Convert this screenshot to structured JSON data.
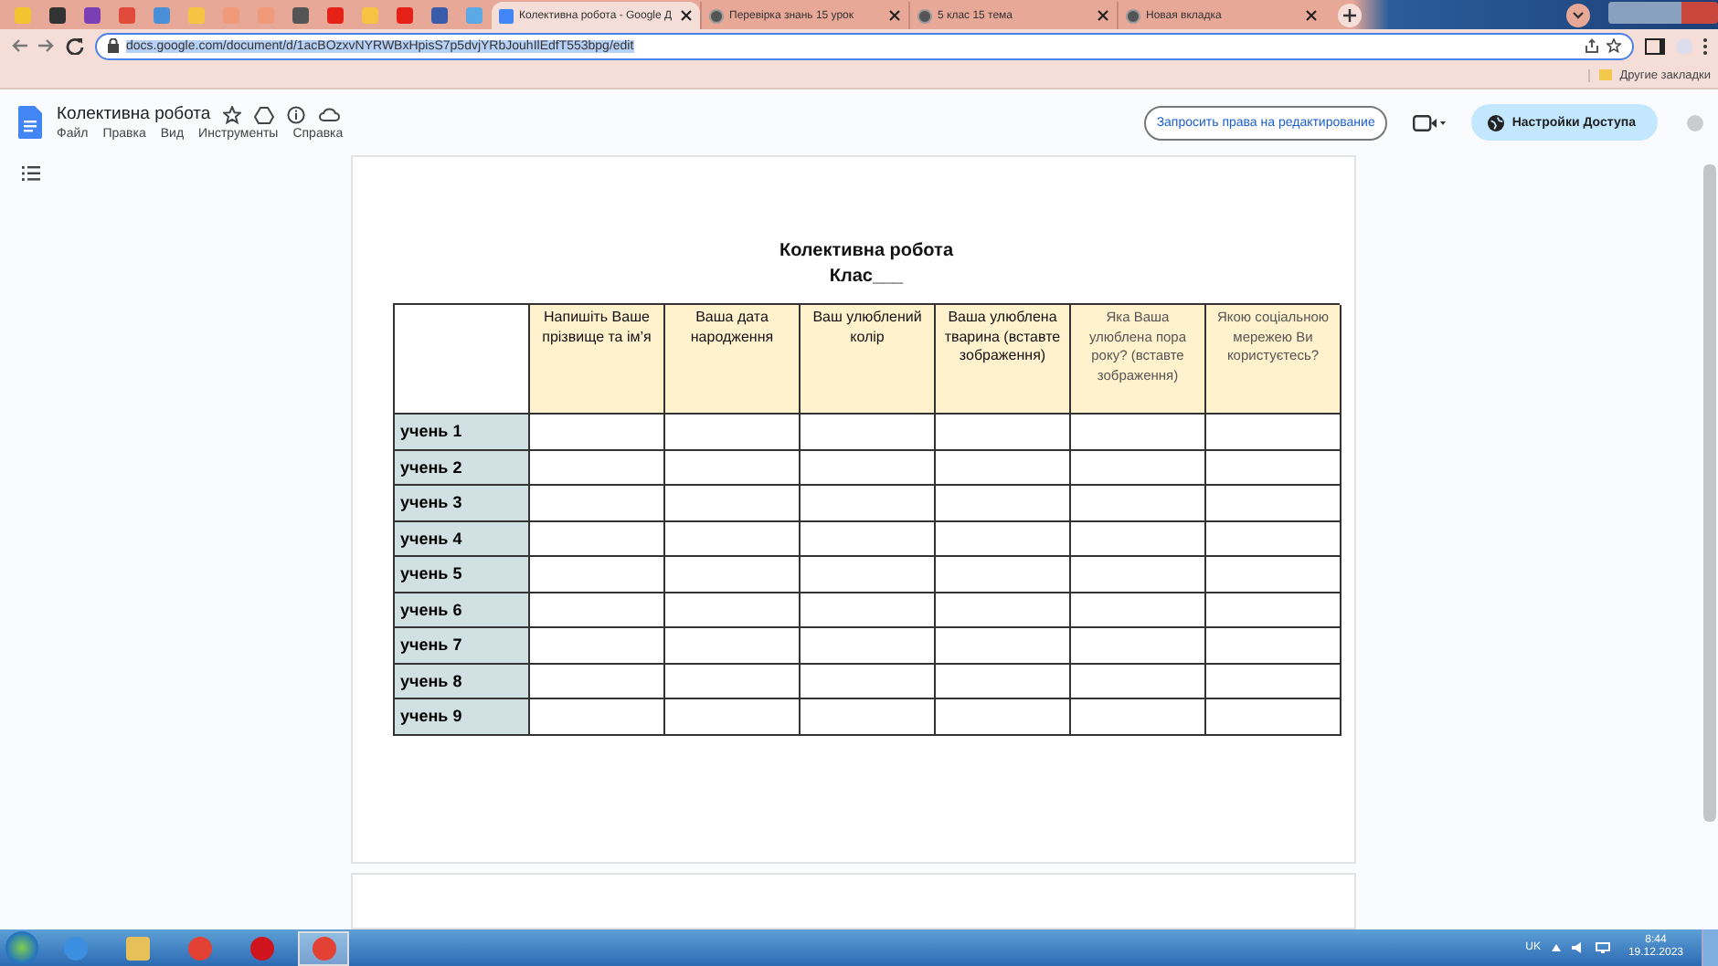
{
  "browser": {
    "tabs": [
      {
        "title": "Колективна робота - Google Д",
        "selected": true
      },
      {
        "title": "Перевірка знань 15 урок",
        "selected": false
      },
      {
        "title": "5 клас 15 тема",
        "selected": false
      },
      {
        "title": "Новая вкладка",
        "selected": false
      }
    ],
    "url": "docs.google.com/document/d/1acBOzxvNYRWBxHpisS7p5dvjYRbJouhIlEdfT553bpg/edit",
    "bookmarks": [
      "Другие закладки"
    ]
  },
  "docs": {
    "title": "Колективна робота",
    "menu": [
      "Файл",
      "Правка",
      "Вид",
      "Инструменты",
      "Справка"
    ],
    "request_button": "Запросить права на редактирование",
    "share_button": "Настройки Доступа"
  },
  "document": {
    "heading": "Колективна робота",
    "subheading": "Клас___",
    "table": {
      "columns": [
        {
          "label": "Напишіть Ваше прізвище та ім’я",
          "muted": false
        },
        {
          "label": "Ваша дата народження",
          "muted": false
        },
        {
          "label": "Ваш улюблений колір",
          "muted": false
        },
        {
          "label": "Ваша улюблена тварина (вставте зображення)",
          "muted": false
        },
        {
          "label": "Яка Ваша улюблена пора року? (вставте зображення)",
          "muted": true
        },
        {
          "label": "Якою соціальною мережею Ви користуєтесь?",
          "muted": true
        }
      ],
      "rows": [
        "учень 1",
        "учень 2",
        "учень 3",
        "учень 4",
        "учень 5",
        "учень 6",
        "учень 7",
        "учень 8",
        "учень 9"
      ]
    }
  },
  "taskbar": {
    "language": "UK",
    "time": "8:44",
    "date": "19.12.2023"
  }
}
